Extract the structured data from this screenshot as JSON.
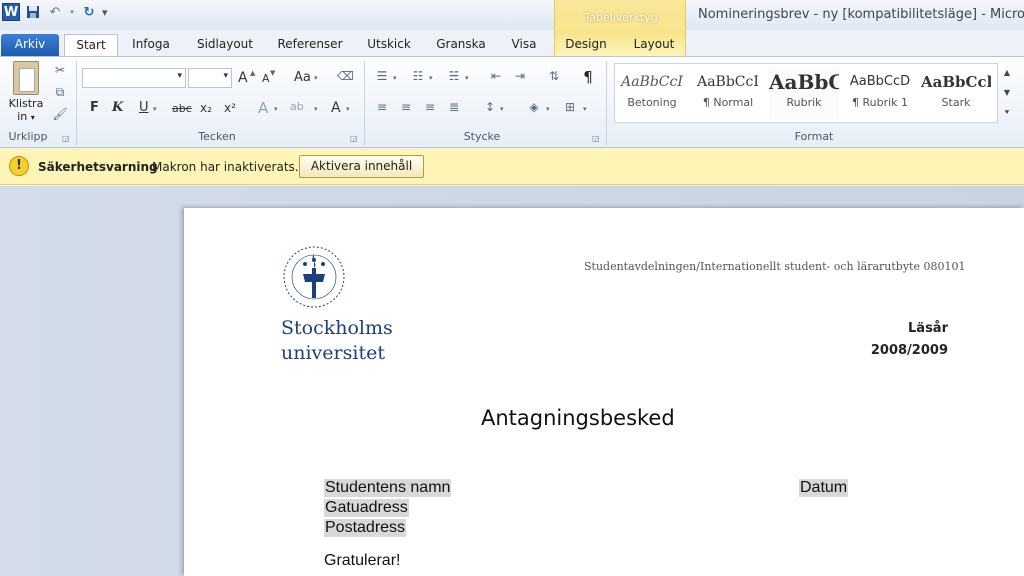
{
  "window": {
    "title": "Nomineringsbrev - ny [kompatibilitetsläge]  -  Micros"
  },
  "context_tab": {
    "label": "Tabellverktyg"
  },
  "tabs": [
    {
      "label": "Arkiv"
    },
    {
      "label": "Start"
    },
    {
      "label": "Infoga"
    },
    {
      "label": "Sidlayout"
    },
    {
      "label": "Referenser"
    },
    {
      "label": "Utskick"
    },
    {
      "label": "Granska"
    },
    {
      "label": "Visa"
    },
    {
      "label": "Design"
    },
    {
      "label": "Layout"
    }
  ],
  "ribbon": {
    "paste_label_1": "Klistra",
    "paste_label_2": "in",
    "groups": {
      "clipboard": "Urklipp",
      "font": "Tecken",
      "paragraph": "Stycke",
      "styles": "Format"
    },
    "font_buttons": {
      "bold": "F",
      "italic": "K",
      "underline": "U",
      "strike": "abc",
      "subscript": "x₂",
      "superscript": "x²",
      "grow": "A",
      "shrink": "A",
      "case": "Aa",
      "effects": "A",
      "highlight": "ab",
      "color": "A"
    },
    "styles": [
      {
        "sample": "AaBbCcI",
        "name": "Betoning"
      },
      {
        "sample": "AaBbCcI",
        "name": "¶ Normal"
      },
      {
        "sample": "AaBbC",
        "name": "Rubrik"
      },
      {
        "sample": "AaBbCcD",
        "name": "¶ Rubrik 1"
      },
      {
        "sample": "AaBbCcl",
        "name": "Stark"
      }
    ]
  },
  "security_bar": {
    "title": "Säkerhetsvarning",
    "message": "Makron har inaktiverats.",
    "button": "Aktivera innehåll"
  },
  "document": {
    "logo_line_1": "Stockholms",
    "logo_line_2": "universitet",
    "department": "Studentavdelningen/Internationellt  student- och lärarutbyte 080101",
    "year_label": "Läsår",
    "year_value": "2008/2009",
    "title": "Antagningsbesked",
    "student_name": "Studentens namn",
    "date": "Datum",
    "street": "Gatuadress",
    "postal": "Postadress",
    "greeting": "Gratulerar!"
  },
  "colors": {
    "accent": "#2a5caa",
    "security_bar": "#fdf4b6",
    "context_tab": "#f6e58c",
    "logo_blue": "#1d3f7a"
  }
}
